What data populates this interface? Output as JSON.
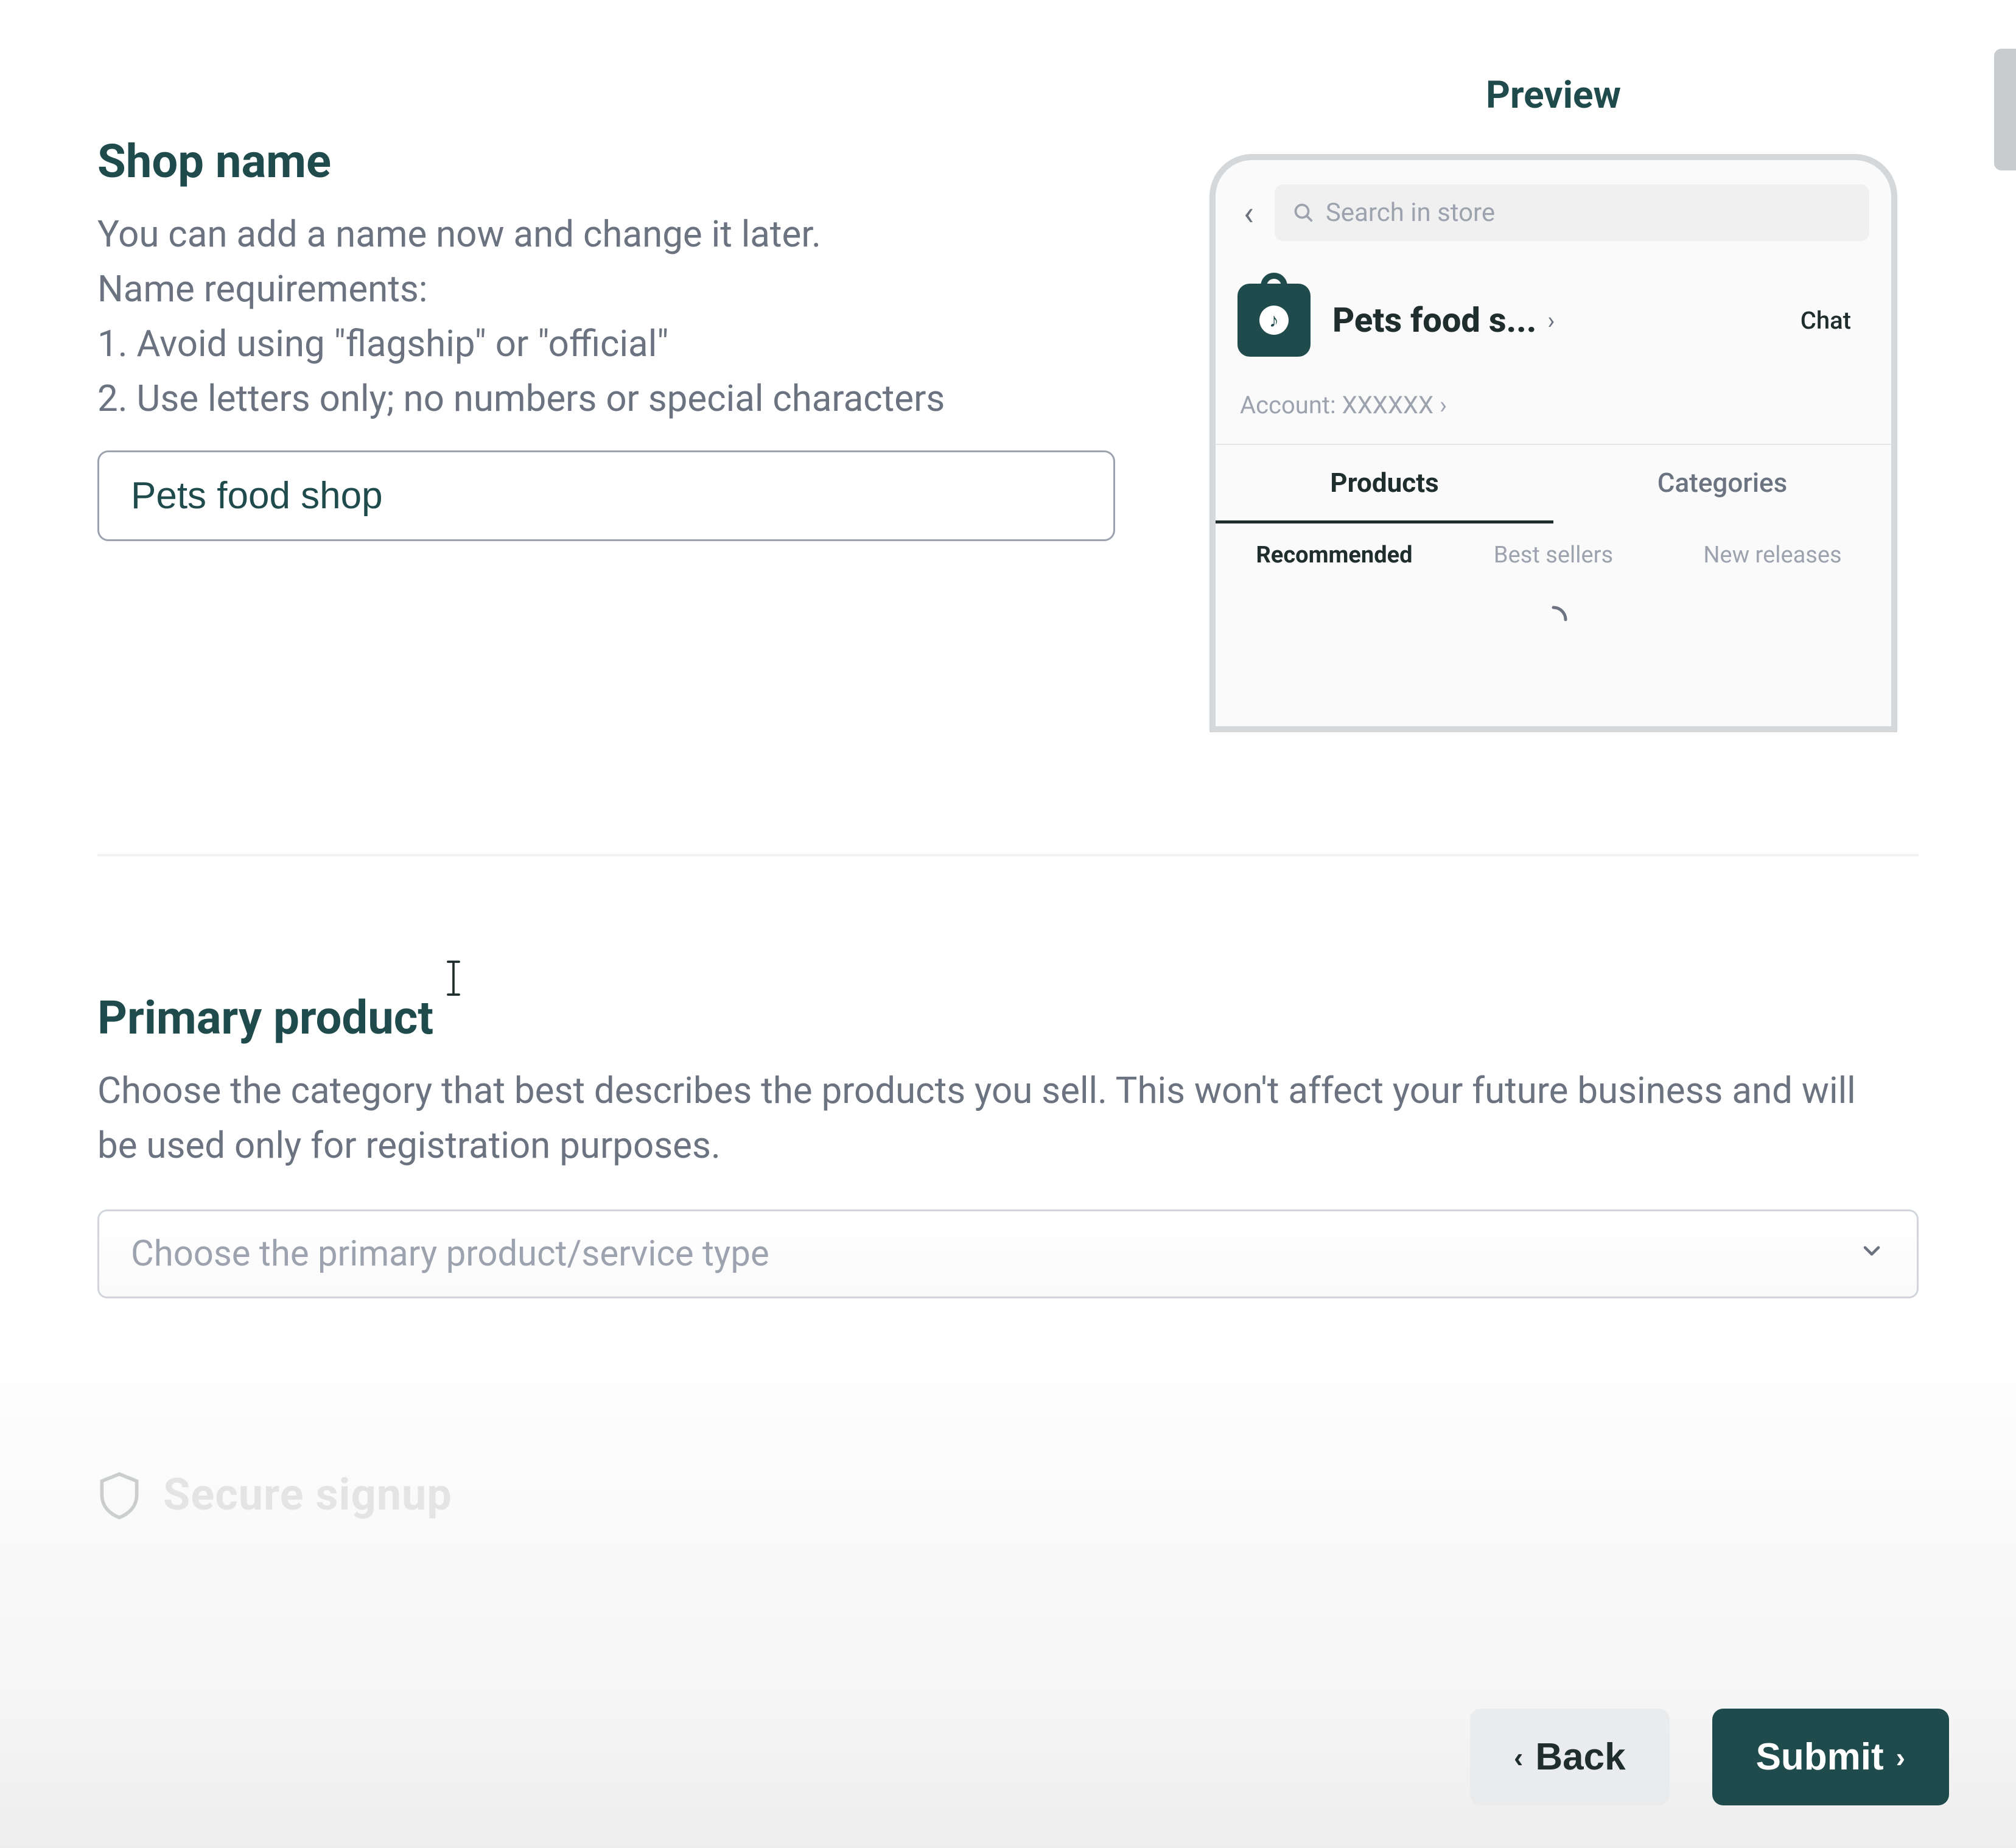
{
  "shop_name_section": {
    "title": "Shop name",
    "help_intro": "You can add a name now and change it later.",
    "help_req_title": "Name requirements:",
    "help_req_1": "1. Avoid using \"flagship\" or \"official\"",
    "help_req_2": "2. Use letters only; no numbers or special characters",
    "input_value": "Pets food shop"
  },
  "preview": {
    "title": "Preview",
    "search_placeholder": "Search in store",
    "shop_name_display": "Pets food s...",
    "chat_label": "Chat",
    "account_label": "Account: XXXXXX",
    "tabs": {
      "products": "Products",
      "categories": "Categories"
    },
    "sub_tabs": {
      "recommended": "Recommended",
      "best_sellers": "Best sellers",
      "new_releases": "New releases"
    }
  },
  "primary_product": {
    "title": "Primary product",
    "help": "Choose the category that best describes the products you sell. This won't affect your future business and will be used only for registration purposes.",
    "placeholder": "Choose the primary product/service type"
  },
  "secure": {
    "title": "Secure signup"
  },
  "footer": {
    "back": "Back",
    "submit": "Submit"
  }
}
